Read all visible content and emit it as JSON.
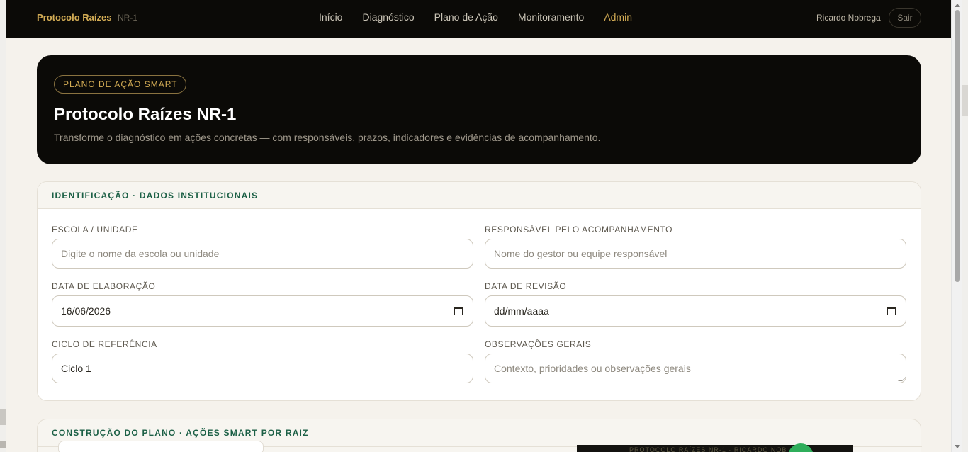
{
  "nav": {
    "brand": "Protocolo Raízes",
    "brand_tag": "NR-1",
    "links": [
      "Início",
      "Diagnóstico",
      "Plano de Ação",
      "Monitoramento",
      "Admin"
    ],
    "active_link": "Admin",
    "user_name": "Ricardo Nobrega",
    "logout_label": "Sair"
  },
  "hero": {
    "badge": "PLANO DE AÇÃO SMART",
    "title": "Protocolo Raízes NR-1",
    "subtitle": "Transforme o diagnóstico em ações concretas — com responsáveis, prazos, indicadores e evidências de acompanhamento."
  },
  "identificacao": {
    "title": "IDENTIFICAÇÃO · DADOS INSTITUCIONAIS",
    "escola_label": "ESCOLA / UNIDADE",
    "escola_placeholder": "Digite o nome da escola ou unidade",
    "responsavel_label": "RESPONSÁVEL PELO ACOMPANHAMENTO",
    "responsavel_placeholder": "Nome do gestor ou equipe responsável",
    "data_elaboracao_label": "DATA DE ELABORAÇÃO",
    "data_elaboracao_value": "16/06/2026",
    "data_revisao_label": "DATA DE REVISÃO",
    "data_revisao_value": "dd/mm/aaaa",
    "ciclo_label": "CICLO DE REFERÊNCIA",
    "ciclo_value": "Ciclo 1",
    "observacoes_label": "OBSERVAÇÕES GERAIS",
    "observacoes_placeholder": "Contexto, prioridades ou observações gerais"
  },
  "construcao": {
    "title": "CONSTRUÇÃO DO PLANO · AÇÕES SMART POR RAIZ"
  },
  "background": {
    "fragment_text": "PROTOCOLO RAÍZES NR-1 · RICARDO NOB"
  },
  "colors": {
    "nav_bg": "#0b0a07",
    "accent_gold": "#d4ad55",
    "section_green": "#1c6046",
    "page_bg": "#f5f2ec"
  }
}
